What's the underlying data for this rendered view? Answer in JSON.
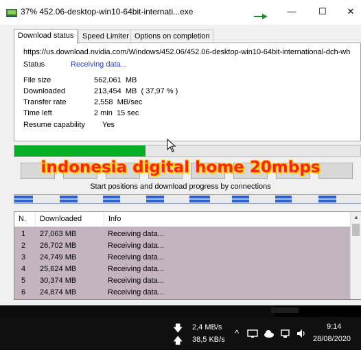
{
  "window": {
    "title": "37% 452.06-desktop-win10-64bit-internati...exe",
    "minimize_glyph": "—",
    "maximize_glyph": "☐",
    "close_glyph": "✕"
  },
  "tabs": [
    {
      "label": "Download status",
      "active": true
    },
    {
      "label": "Speed Limiter",
      "active": false
    },
    {
      "label": "Options on completion",
      "active": false
    }
  ],
  "download": {
    "url": "https://us.download.nvidia.com/Windows/452.06/452.06-desktop-win10-64bit-international-dch-wh",
    "status_label": "Status",
    "status_value": "Receiving data...",
    "file_size_label": "File size",
    "file_size_value": "562,061  MB",
    "downloaded_label": "Downloaded",
    "downloaded_value": "213,454  MB  ( 37,97 % )",
    "transfer_rate_label": "Transfer rate",
    "transfer_rate_value": "2,558  MB/sec",
    "time_left_label": "Time left",
    "time_left_value": "2 min  15 sec",
    "resume_label": "Resume capability",
    "resume_value": "    Yes",
    "progress_fraction": 0.3797
  },
  "overlay_caption": "indonesia digital home 20mbps",
  "connections": {
    "caption": "Start positions and download progress by connections",
    "columns": [
      "N.",
      "Downloaded",
      "Info"
    ],
    "rows": [
      {
        "n": "1",
        "downloaded": "27,063  MB",
        "info": "Receiving data..."
      },
      {
        "n": "2",
        "downloaded": "26,702  MB",
        "info": "Receiving data..."
      },
      {
        "n": "3",
        "downloaded": "24,749  MB",
        "info": "Receiving data..."
      },
      {
        "n": "4",
        "downloaded": "25,624  MB",
        "info": "Receiving data..."
      },
      {
        "n": "5",
        "downloaded": "30,374  MB",
        "info": "Receiving data..."
      },
      {
        "n": "6",
        "downloaded": "24,874  MB",
        "info": "Receiving data..."
      }
    ]
  },
  "taskbar": {
    "download_speed": "2,4 MB/s",
    "upload_speed": "38,5 KB/s",
    "time": "9:14",
    "date": "28/08/2020",
    "down_arrow_glyph": "🡇",
    "up_arrow_glyph": "🡅"
  },
  "colors": {
    "progress_green": "#06b025",
    "status_blue": "#1f3fcf",
    "connection_blue": "#2d5fd6",
    "table_bg": "#c4b4bf",
    "overlay_red": "#ff2020"
  }
}
